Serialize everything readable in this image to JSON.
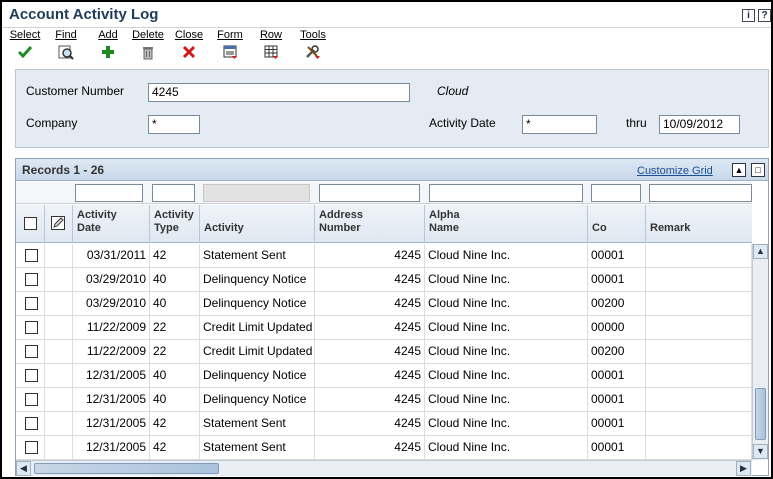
{
  "window": {
    "title": "Account Activity Log"
  },
  "title_icons": [
    "info-icon",
    "help-icon"
  ],
  "toolbar": [
    {
      "key": "select",
      "label": "Select",
      "icon": "checkmark-icon"
    },
    {
      "key": "find",
      "label": "Find",
      "icon": "binoculars-icon"
    },
    {
      "key": "add",
      "label": "Add",
      "icon": "plus-icon"
    },
    {
      "key": "delete",
      "label": "Delete",
      "icon": "trash-icon"
    },
    {
      "key": "close",
      "label": "Close",
      "icon": "close-icon"
    },
    {
      "key": "form",
      "label": "Form",
      "icon": "form-menu-icon"
    },
    {
      "key": "row",
      "label": "Row",
      "icon": "row-menu-icon"
    },
    {
      "key": "tools",
      "label": "Tools",
      "icon": "tools-menu-icon"
    }
  ],
  "filters": {
    "customer_number_label": "Customer Number",
    "customer_number_value": "4245",
    "customer_name": "Cloud",
    "company_label": "Company",
    "company_value": "*",
    "activity_date_label": "Activity Date",
    "activity_date_value": "*",
    "thru_label": "thru",
    "thru_value": "10/09/2012"
  },
  "grid": {
    "title": "Records 1 - 26",
    "customize_label": "Customize Grid",
    "columns": [
      {
        "key": "activity_date",
        "line1": "Activity",
        "line2": "Date"
      },
      {
        "key": "activity_type",
        "line1": "Activity",
        "line2": "Type"
      },
      {
        "key": "activity",
        "line1": "",
        "line2": "Activity"
      },
      {
        "key": "address_number",
        "line1": "Address",
        "line2": "Number"
      },
      {
        "key": "alpha_name",
        "line1": "Alpha",
        "line2": "Name"
      },
      {
        "key": "co",
        "line1": "",
        "line2": "Co"
      },
      {
        "key": "remark",
        "line1": "",
        "line2": "Remark"
      }
    ],
    "rows": [
      {
        "date": "03/31/2011",
        "type": "42",
        "activity": "Statement Sent",
        "address": "4245",
        "name": "Cloud Nine Inc.",
        "co": "00001",
        "remark": ""
      },
      {
        "date": "03/29/2010",
        "type": "40",
        "activity": "Delinquency Notice",
        "address": "4245",
        "name": "Cloud Nine Inc.",
        "co": "00001",
        "remark": ""
      },
      {
        "date": "03/29/2010",
        "type": "40",
        "activity": "Delinquency Notice",
        "address": "4245",
        "name": "Cloud Nine Inc.",
        "co": "00200",
        "remark": ""
      },
      {
        "date": "11/22/2009",
        "type": "22",
        "activity": "Credit Limit Updated",
        "address": "4245",
        "name": "Cloud Nine Inc.",
        "co": "00000",
        "remark": ""
      },
      {
        "date": "11/22/2009",
        "type": "22",
        "activity": "Credit Limit Updated",
        "address": "4245",
        "name": "Cloud Nine Inc.",
        "co": "00200",
        "remark": ""
      },
      {
        "date": "12/31/2005",
        "type": "40",
        "activity": "Delinquency Notice",
        "address": "4245",
        "name": "Cloud Nine Inc.",
        "co": "00001",
        "remark": ""
      },
      {
        "date": "12/31/2005",
        "type": "40",
        "activity": "Delinquency Notice",
        "address": "4245",
        "name": "Cloud Nine Inc.",
        "co": "00001",
        "remark": ""
      },
      {
        "date": "12/31/2005",
        "type": "42",
        "activity": "Statement Sent",
        "address": "4245",
        "name": "Cloud Nine Inc.",
        "co": "00001",
        "remark": ""
      },
      {
        "date": "12/31/2005",
        "type": "42",
        "activity": "Statement Sent",
        "address": "4245",
        "name": "Cloud Nine Inc.",
        "co": "00001",
        "remark": ""
      }
    ]
  },
  "colors": {
    "accent": "#1f3b5a",
    "link": "#1b4e96",
    "green": "#1f8a1f",
    "red": "#d01818"
  }
}
